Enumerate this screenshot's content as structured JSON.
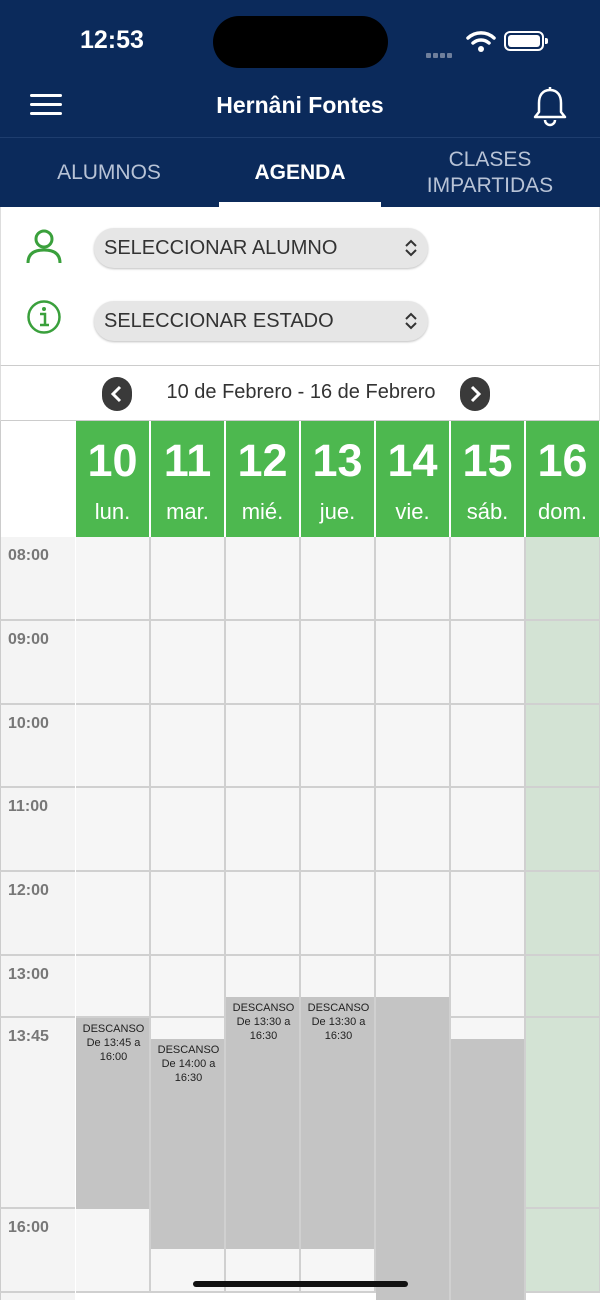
{
  "status": {
    "time": "12:53"
  },
  "header": {
    "title": "Hernâni Fontes",
    "menu_icon": "hamburger-icon",
    "bell_icon": "bell-icon"
  },
  "tabs": [
    {
      "label": "ALUMNOS"
    },
    {
      "label": "AGENDA",
      "active": true
    },
    {
      "label": "CLASES IMPARTIDAS"
    }
  ],
  "filters": {
    "student": "SELECCIONAR ALUMNO",
    "state": "SELECCIONAR ESTADO"
  },
  "week": {
    "label": "10 de Febrero - 16 de Febrero"
  },
  "days": [
    {
      "num": "10",
      "name": "lun."
    },
    {
      "num": "11",
      "name": "mar."
    },
    {
      "num": "12",
      "name": "mié."
    },
    {
      "num": "13",
      "name": "jue."
    },
    {
      "num": "14",
      "name": "vie."
    },
    {
      "num": "15",
      "name": "sáb."
    },
    {
      "num": "16",
      "name": "dom."
    }
  ],
  "times": [
    "08:00",
    "09:00",
    "10:00",
    "11:00",
    "12:00",
    "13:00",
    "13:45",
    "16:00"
  ],
  "events": [
    {
      "day": 0,
      "title": "DESCANSO",
      "detail": "De 13:45 a 16:00"
    },
    {
      "day": 1,
      "title": "DESCANSO",
      "detail": "De 14:00 a 16:30"
    },
    {
      "day": 2,
      "title": "DESCANSO",
      "detail": "De 13:30 a 16:30"
    },
    {
      "day": 3,
      "title": "DESCANSO",
      "detail": "De 13:30 a 16:30"
    }
  ],
  "colors": {
    "header_bg": "#0b2a5b",
    "day_header": "#4db84f",
    "sunday_bg": "#d3e3d4",
    "block_bg": "#c4c4c4",
    "icon_green": "#3aa03c"
  }
}
